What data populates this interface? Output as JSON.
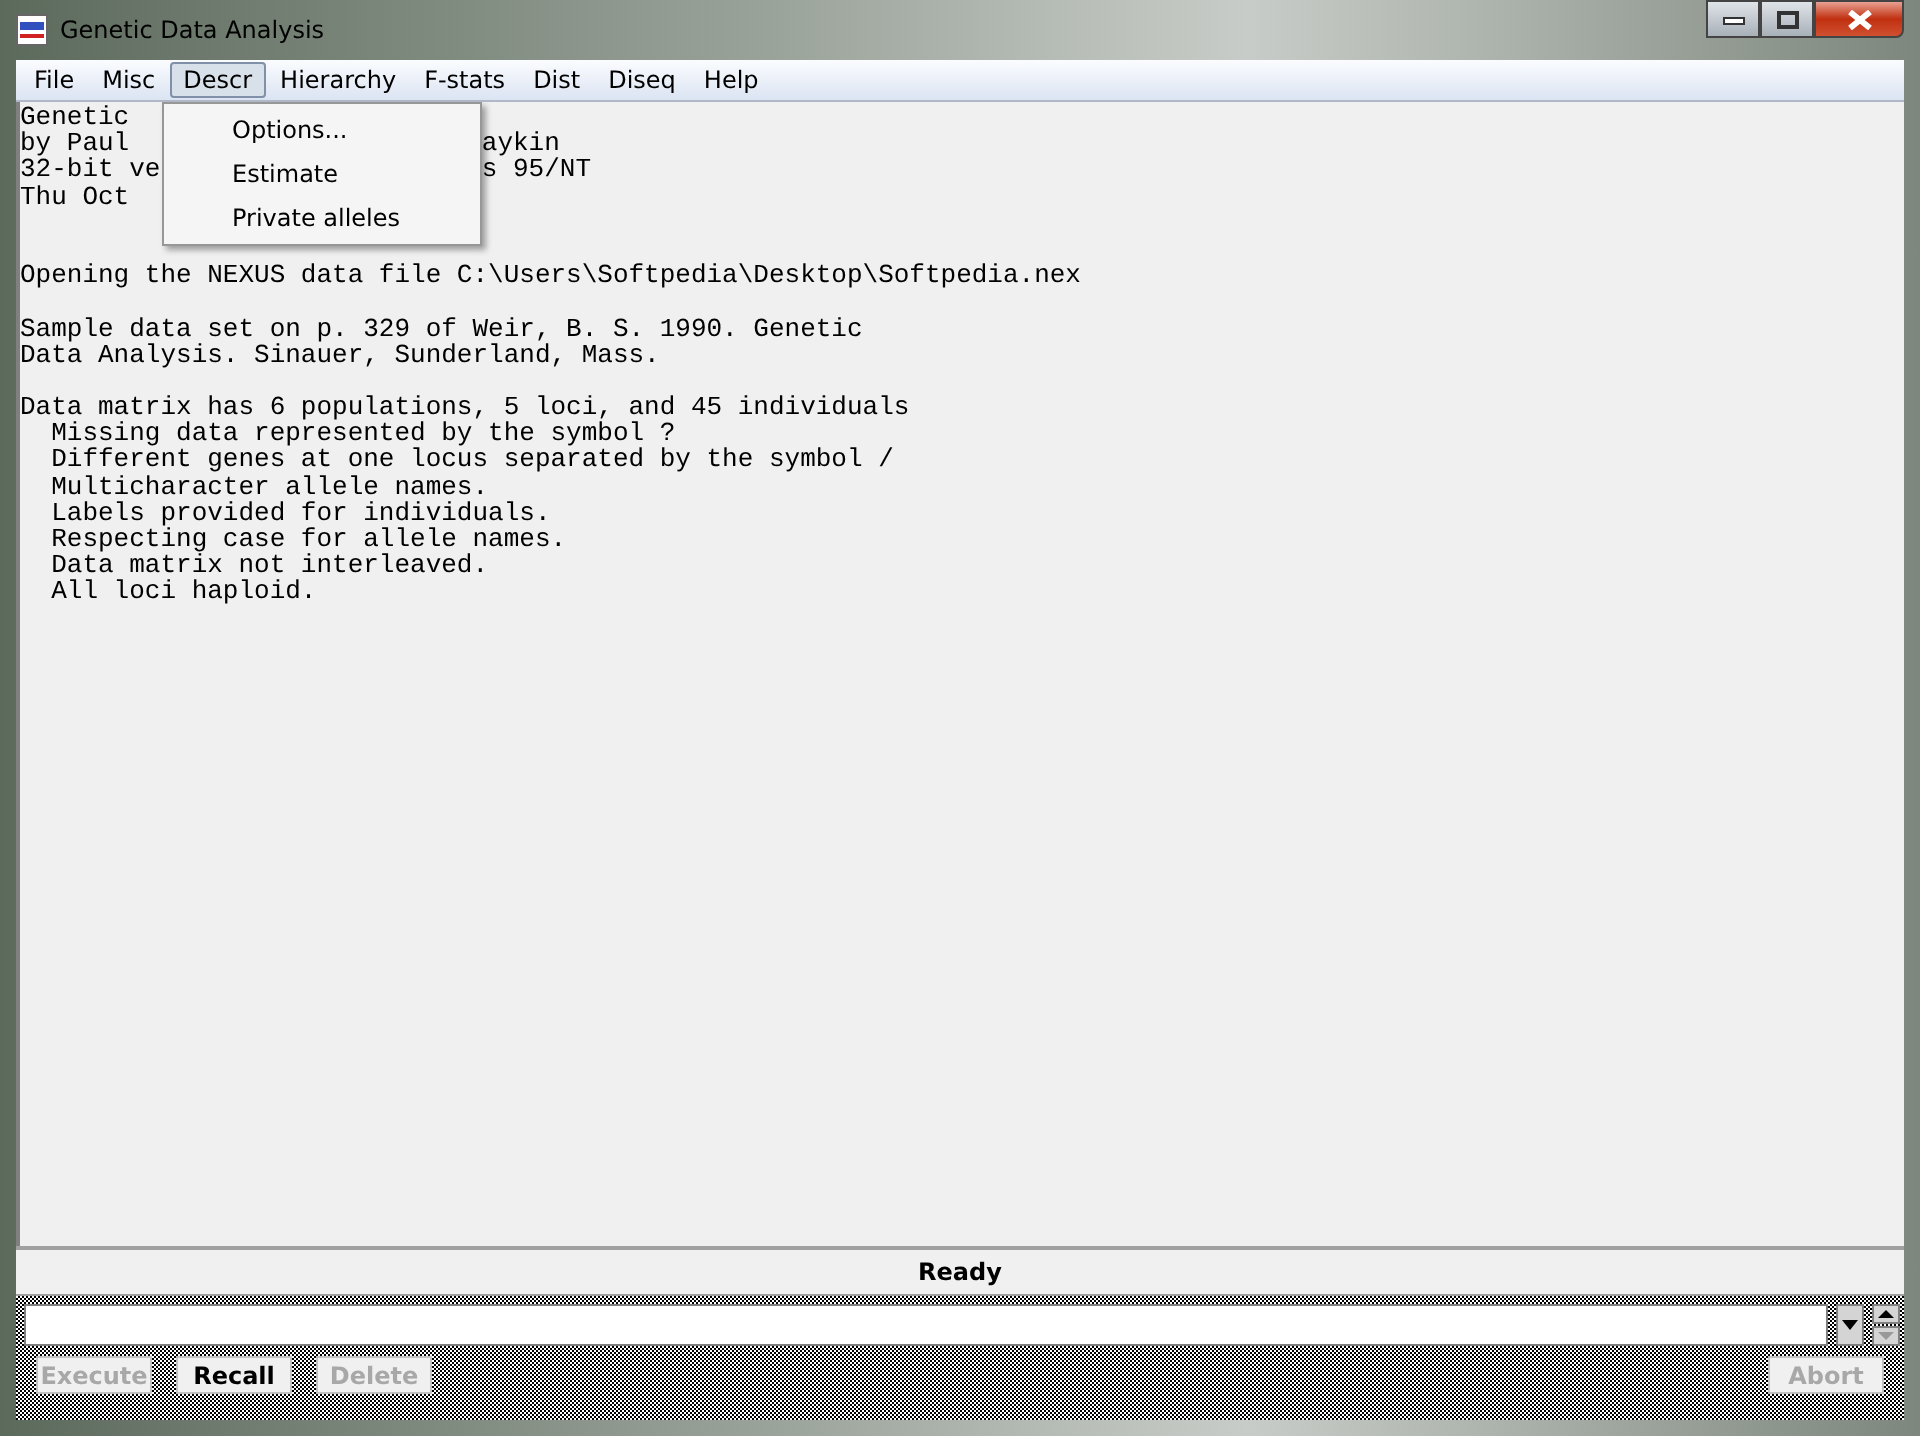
{
  "window": {
    "title": "Genetic Data Analysis"
  },
  "menu": [
    {
      "label": "File",
      "selected": false
    },
    {
      "label": "Misc",
      "selected": false
    },
    {
      "label": "Descr",
      "selected": true
    },
    {
      "label": "Hierarchy",
      "selected": false
    },
    {
      "label": "F-stats",
      "selected": false
    },
    {
      "label": "Dist",
      "selected": false
    },
    {
      "label": "Diseq",
      "selected": false
    },
    {
      "label": "Help",
      "selected": false
    }
  ],
  "dropdown": [
    "Options...",
    "Estimate",
    "Private alleles"
  ],
  "header_lines": [
    {
      "left": "Genetic"
    },
    {
      "left": "by Paul",
      "right": "aykin"
    },
    {
      "left": "32-bit ve",
      "right": "s 95/NT"
    },
    {
      "left": "Thu Oct"
    }
  ],
  "paragraphs": [
    [
      "Opening the NEXUS data file C:\\Users\\Softpedia\\Desktop\\Softpedia.nex"
    ],
    [
      "Sample data set on p. 329 of Weir, B. S. 1990. Genetic",
      "Data Analysis. Sinauer, Sunderland, Mass."
    ],
    [
      "Data matrix has 6 populations, 5 loci, and 45 individuals",
      "  Missing data represented by the symbol ?",
      "  Different genes at one locus separated by the symbol /",
      "  Multicharacter allele names.",
      "  Labels provided for individuals.",
      "  Respecting case for allele names.",
      "  Data matrix not interleaved.",
      "  All loci haploid."
    ]
  ],
  "status": "Ready",
  "buttons": [
    {
      "label": "Execute",
      "disabled": true
    },
    {
      "label": "Recall",
      "disabled": false
    },
    {
      "label": "Delete",
      "disabled": true
    }
  ],
  "abort": {
    "label": "Abort",
    "disabled": true
  }
}
